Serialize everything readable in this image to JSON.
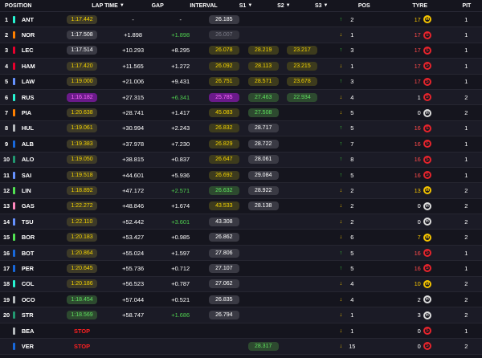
{
  "headers": {
    "position": "POSITION",
    "lap_time": "LAP TIME",
    "gap": "GAP",
    "interval": "INTERVAL",
    "s1": "S1",
    "s2": "S2",
    "s3": "S3",
    "pos": "POS",
    "tyre": "TYRE",
    "pit": "PIT"
  },
  "rows": [
    {
      "pos": "1",
      "team_color": "#27f4d2",
      "driver": "ANT",
      "lap": "1:17.442",
      "lap_style": "yellow",
      "gap": "-",
      "interval": "-",
      "int_style": "white",
      "s1": "26.185",
      "s1_style": "white",
      "s2": "",
      "s2_style": "",
      "s3": "",
      "s3_style": "",
      "dir": "up",
      "chg": "2",
      "tyre_age": "17",
      "age_style": "yellow",
      "tyre": "M",
      "pit": "1"
    },
    {
      "pos": "2",
      "team_color": "#ff8000",
      "driver": "NOR",
      "lap": "1:17.508",
      "lap_style": "white",
      "gap": "+1.898",
      "interval": "+1.898",
      "int_style": "green",
      "s1": "26.007",
      "s1_style": "grey",
      "s2": "",
      "s2_style": "",
      "s3": "",
      "s3_style": "",
      "dir": "down",
      "chg": "1",
      "tyre_age": "17",
      "age_style": "red",
      "tyre": "S",
      "pit": "1"
    },
    {
      "pos": "3",
      "team_color": "#e8002d",
      "driver": "LEC",
      "lap": "1:17.514",
      "lap_style": "white",
      "gap": "+10.293",
      "interval": "+8.295",
      "int_style": "white",
      "s1": "26.078",
      "s1_style": "yellow",
      "s2": "28.219",
      "s2_style": "yellow",
      "s3": "23.217",
      "s3_style": "yellow",
      "dir": "up",
      "chg": "3",
      "tyre_age": "17",
      "age_style": "red",
      "tyre": "S",
      "pit": "1"
    },
    {
      "pos": "4",
      "team_color": "#e8002d",
      "driver": "HAM",
      "lap": "1:17.420",
      "lap_style": "yellow",
      "gap": "+11.565",
      "interval": "+1.272",
      "int_style": "white",
      "s1": "26.092",
      "s1_style": "yellow",
      "s2": "28.113",
      "s2_style": "yellow",
      "s3": "23.215",
      "s3_style": "yellow",
      "dir": "down",
      "chg": "1",
      "tyre_age": "17",
      "age_style": "red",
      "tyre": "S",
      "pit": "1"
    },
    {
      "pos": "5",
      "team_color": "#6692ff",
      "driver": "LAW",
      "lap": "1:19.000",
      "lap_style": "yellow",
      "gap": "+21.006",
      "interval": "+9.431",
      "int_style": "white",
      "s1": "26.751",
      "s1_style": "yellow",
      "s2": "28.571",
      "s2_style": "yellow",
      "s3": "23.678",
      "s3_style": "yellow",
      "dir": "up",
      "chg": "3",
      "tyre_age": "17",
      "age_style": "red",
      "tyre": "S",
      "pit": "1"
    },
    {
      "pos": "6",
      "team_color": "#27f4d2",
      "driver": "RUS",
      "lap": "1:16.182",
      "lap_style": "purple",
      "gap": "+27.315",
      "interval": "+6.341",
      "int_style": "green",
      "s1": "25.785",
      "s1_style": "purple",
      "s2": "27.463",
      "s2_style": "green",
      "s3": "22.934",
      "s3_style": "green",
      "dir": "down",
      "chg": "4",
      "tyre_age": "1",
      "age_style": "white",
      "tyre": "S",
      "pit": "2"
    },
    {
      "pos": "7",
      "team_color": "#ff8000",
      "driver": "PIA",
      "lap": "1:20.638",
      "lap_style": "yellow",
      "gap": "+28.741",
      "interval": "+1.417",
      "int_style": "white",
      "s1": "45.083",
      "s1_style": "yellow",
      "s2": "27.508",
      "s2_style": "green",
      "s3": "",
      "s3_style": "",
      "dir": "down",
      "chg": "5",
      "tyre_age": "0",
      "age_style": "white",
      "tyre": "H",
      "pit": "2"
    },
    {
      "pos": "8",
      "team_color": "#b6babd",
      "driver": "HUL",
      "lap": "1:19.061",
      "lap_style": "yellow",
      "gap": "+30.994",
      "interval": "+2.243",
      "int_style": "white",
      "s1": "26.832",
      "s1_style": "yellow",
      "s2": "28.717",
      "s2_style": "white",
      "s3": "",
      "s3_style": "",
      "dir": "up",
      "chg": "5",
      "tyre_age": "16",
      "age_style": "red",
      "tyre": "S",
      "pit": "1"
    },
    {
      "pos": "9",
      "team_color": "#1868db",
      "driver": "ALB",
      "lap": "1:19.383",
      "lap_style": "yellow",
      "gap": "+37.978",
      "interval": "+7.230",
      "int_style": "white",
      "s1": "26.829",
      "s1_style": "yellow",
      "s2": "28.722",
      "s2_style": "white",
      "s3": "",
      "s3_style": "",
      "dir": "up",
      "chg": "7",
      "tyre_age": "16",
      "age_style": "red",
      "tyre": "S",
      "pit": "1"
    },
    {
      "pos": "10",
      "team_color": "#229971",
      "driver": "ALO",
      "lap": "1:19.050",
      "lap_style": "yellow",
      "gap": "+38.815",
      "interval": "+0.837",
      "int_style": "white",
      "s1": "26.647",
      "s1_style": "yellow",
      "s2": "28.061",
      "s2_style": "white",
      "s3": "",
      "s3_style": "",
      "dir": "up",
      "chg": "8",
      "tyre_age": "16",
      "age_style": "red",
      "tyre": "S",
      "pit": "1"
    },
    {
      "pos": "11",
      "team_color": "#6692ff",
      "driver": "SAI",
      "lap": "1:19.518",
      "lap_style": "yellow",
      "gap": "+44.601",
      "interval": "+5.936",
      "int_style": "white",
      "s1": "26.692",
      "s1_style": "yellow",
      "s2": "29.084",
      "s2_style": "white",
      "s3": "",
      "s3_style": "",
      "dir": "up",
      "chg": "5",
      "tyre_age": "16",
      "age_style": "red",
      "tyre": "S",
      "pit": "1"
    },
    {
      "pos": "12",
      "team_color": "#52e252",
      "driver": "LIN",
      "lap": "1:18.892",
      "lap_style": "yellow",
      "gap": "+47.172",
      "interval": "+2.571",
      "int_style": "green",
      "s1": "26.632",
      "s1_style": "green",
      "s2": "28.922",
      "s2_style": "white",
      "s3": "",
      "s3_style": "",
      "dir": "down",
      "chg": "2",
      "tyre_age": "13",
      "age_style": "yellow",
      "tyre": "M",
      "pit": "2"
    },
    {
      "pos": "13",
      "team_color": "#ff87bc",
      "driver": "GAS",
      "lap": "1:22.272",
      "lap_style": "yellow",
      "gap": "+48.846",
      "interval": "+1.674",
      "int_style": "white",
      "s1": "43.533",
      "s1_style": "yellow",
      "s2": "28.138",
      "s2_style": "white",
      "s3": "",
      "s3_style": "",
      "dir": "down",
      "chg": "2",
      "tyre_age": "0",
      "age_style": "white",
      "tyre": "H",
      "pit": "2"
    },
    {
      "pos": "14",
      "team_color": "#6692ff",
      "driver": "TSU",
      "lap": "1:22.110",
      "lap_style": "yellow",
      "gap": "+52.442",
      "interval": "+3.601",
      "int_style": "green",
      "s1": "43.308",
      "s1_style": "white",
      "s2": "",
      "s2_style": "",
      "s3": "",
      "s3_style": "",
      "dir": "down",
      "chg": "2",
      "tyre_age": "0",
      "age_style": "white",
      "tyre": "H",
      "pit": "2"
    },
    {
      "pos": "15",
      "team_color": "#52e252",
      "driver": "BOR",
      "lap": "1:20.183",
      "lap_style": "yellow",
      "gap": "+53.427",
      "interval": "+0.985",
      "int_style": "white",
      "s1": "26.862",
      "s1_style": "white",
      "s2": "",
      "s2_style": "",
      "s3": "",
      "s3_style": "",
      "dir": "down",
      "chg": "6",
      "tyre_age": "7",
      "age_style": "yellow",
      "tyre": "M",
      "pit": "2"
    },
    {
      "pos": "16",
      "team_color": "#1868db",
      "driver": "BOT",
      "lap": "1:20.864",
      "lap_style": "yellow",
      "gap": "+55.024",
      "interval": "+1.597",
      "int_style": "white",
      "s1": "27.806",
      "s1_style": "white",
      "s2": "",
      "s2_style": "",
      "s3": "",
      "s3_style": "",
      "dir": "up",
      "chg": "5",
      "tyre_age": "16",
      "age_style": "red",
      "tyre": "S",
      "pit": "1"
    },
    {
      "pos": "17",
      "team_color": "#1868db",
      "driver": "PER",
      "lap": "1:20.645",
      "lap_style": "yellow",
      "gap": "+55.736",
      "interval": "+0.712",
      "int_style": "white",
      "s1": "27.107",
      "s1_style": "white",
      "s2": "",
      "s2_style": "",
      "s3": "",
      "s3_style": "",
      "dir": "up",
      "chg": "5",
      "tyre_age": "16",
      "age_style": "red",
      "tyre": "S",
      "pit": "1"
    },
    {
      "pos": "18",
      "team_color": "#27f4d2",
      "driver": "COL",
      "lap": "1:20.186",
      "lap_style": "yellow",
      "gap": "+56.523",
      "interval": "+0.787",
      "int_style": "white",
      "s1": "27.062",
      "s1_style": "white",
      "s2": "",
      "s2_style": "",
      "s3": "",
      "s3_style": "",
      "dir": "down",
      "chg": "4",
      "tyre_age": "10",
      "age_style": "yellow",
      "tyre": "M",
      "pit": "2"
    },
    {
      "pos": "19",
      "team_color": "#b6babd",
      "driver": "OCO",
      "lap": "1:18.454",
      "lap_style": "green",
      "gap": "+57.044",
      "interval": "+0.521",
      "int_style": "white",
      "s1": "26.835",
      "s1_style": "white",
      "s2": "",
      "s2_style": "",
      "s3": "",
      "s3_style": "",
      "dir": "down",
      "chg": "4",
      "tyre_age": "2",
      "age_style": "white",
      "tyre": "H",
      "pit": "2"
    },
    {
      "pos": "20",
      "team_color": "#229971",
      "driver": "STR",
      "lap": "1:18.569",
      "lap_style": "green",
      "gap": "+58.747",
      "interval": "+1.686",
      "int_style": "green",
      "s1": "26.794",
      "s1_style": "white",
      "s2": "",
      "s2_style": "",
      "s3": "",
      "s3_style": "",
      "dir": "down",
      "chg": "1",
      "tyre_age": "3",
      "age_style": "white",
      "tyre": "H",
      "pit": "2"
    },
    {
      "pos": "",
      "team_color": "#b6babd",
      "driver": "BEA",
      "lap": "STOP",
      "lap_style": "stop",
      "gap": "",
      "interval": "",
      "int_style": "white",
      "s1": "",
      "s1_style": "",
      "s2": "",
      "s2_style": "",
      "s3": "",
      "s3_style": "",
      "dir": "down",
      "chg": "1",
      "tyre_age": "0",
      "age_style": "white",
      "tyre": "S",
      "pit": "1"
    },
    {
      "pos": "",
      "team_color": "#1868db",
      "driver": "VER",
      "lap": "STOP",
      "lap_style": "stop",
      "gap": "",
      "interval": "",
      "int_style": "white",
      "s1": "",
      "s1_style": "",
      "s2": "28.317",
      "s2_style": "green",
      "s3": "",
      "s3_style": "",
      "dir": "down",
      "chg": "15",
      "tyre_age": "0",
      "age_style": "white",
      "tyre": "S",
      "pit": "2"
    }
  ]
}
